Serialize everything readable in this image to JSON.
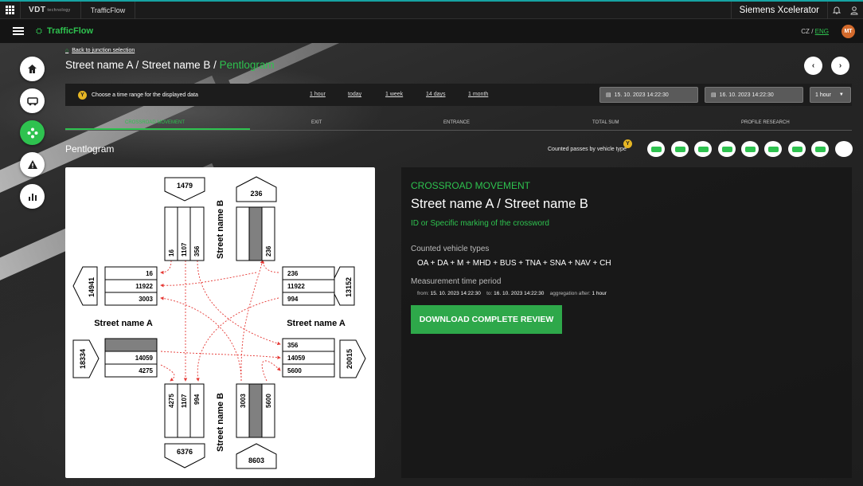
{
  "topbar": {
    "brand": "VDT",
    "brand_sub": "technology",
    "app_tab": "TrafficFlow",
    "platform": "Siemens Xcelerator"
  },
  "navbar": {
    "title": "TrafficFlow",
    "lang_cz": "CZ",
    "lang_sep": "/",
    "lang_eng": "ENG",
    "avatar": "MT"
  },
  "sidebar": [
    {
      "name": "home-icon"
    },
    {
      "name": "vehicle-icon"
    },
    {
      "name": "junction-icon",
      "active": true
    },
    {
      "name": "warning-icon"
    },
    {
      "name": "bar-chart-icon"
    }
  ],
  "header": {
    "back": "Back to junction selection",
    "crumb": "Street name A / Street name B / ",
    "crumb_active": "Pentlogram"
  },
  "time": {
    "badge": "Y",
    "hint": "Choose a time range for the displayed data",
    "links": [
      "1 hour",
      "today",
      "1 week",
      "14 days",
      "1 month"
    ],
    "from": "15. 10. 2023 14:22:30",
    "to": "16. 10. 2023 14:22:30",
    "aggregation": "1 hour"
  },
  "tabs": [
    "CROSSROAD MOVEMENT",
    "EXIT",
    "ENTRANCE",
    "TOTAL SUM",
    "PROFILE RESEARCH"
  ],
  "pentlogram": {
    "title": "Pentlogram",
    "counted_label": "Counted passes by vehicle type",
    "badge": "Y"
  },
  "diagram": {
    "street_a": "Street name A",
    "street_b": "Street name B",
    "n_in": "1479",
    "n_out": "236",
    "w_out": "14941",
    "e_in": "13152",
    "w_in": "18334",
    "e_out": "20015",
    "s_out": "6376",
    "s_in": "8603",
    "n_lanes": [
      "16",
      "1107",
      "356"
    ],
    "n_exit": "236",
    "w_exit": [
      "16",
      "11922",
      "3003"
    ],
    "e_entry": [
      "236",
      "11922",
      "994"
    ],
    "w_entry": [
      "14059",
      "4275"
    ],
    "e_exit": [
      "356",
      "14059",
      "5600"
    ],
    "s_exit": [
      "4275",
      "1107",
      "994"
    ],
    "s_entry": [
      "3003",
      "5600"
    ]
  },
  "info": {
    "heading": "CROSSROAD MOVEMENT",
    "title": "Street name A / Street name B",
    "id": "ID or Specific marking of the crossword",
    "types_label": "Counted vehicle types",
    "types": "OA + DA + M + MHD + BUS + TNA + SNA + NAV + CH",
    "period_label": "Measurement time period",
    "from_label": "from:",
    "from": "15. 10. 2023 14:22:30",
    "to_label": "to:",
    "to": "16. 10. 2023 14:22:30",
    "agg_label": "aggregation after:",
    "agg": "1 hour",
    "download": "DOWNLOAD COMPLETE REVIEW"
  }
}
